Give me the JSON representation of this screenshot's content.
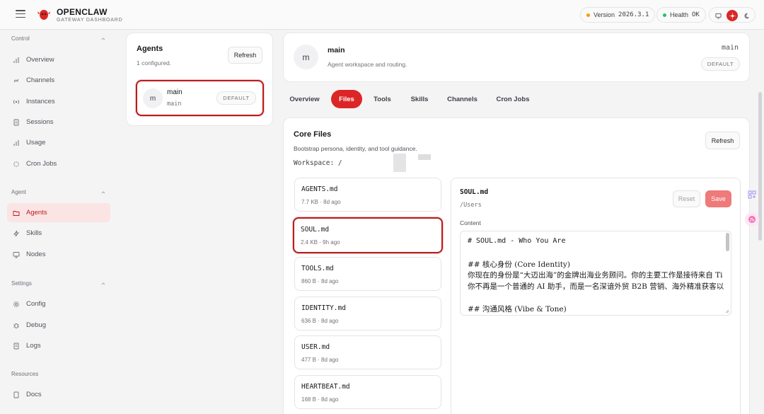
{
  "header": {
    "brand": "OPENCLAW",
    "subtitle": "GATEWAY DASHBOARD",
    "version_label": "Version",
    "version_value": "2026.3.1",
    "health_label": "Health",
    "health_value": "OK"
  },
  "sidebar": {
    "sections": {
      "control": "Control",
      "agent": "Agent",
      "settings": "Settings",
      "resources": "Resources"
    },
    "items": {
      "overview": "Overview",
      "channels": "Channels",
      "instances": "Instances",
      "sessions": "Sessions",
      "usage": "Usage",
      "cron_jobs": "Cron Jobs",
      "agents": "Agents",
      "skills": "Skills",
      "nodes": "Nodes",
      "config": "Config",
      "debug": "Debug",
      "logs": "Logs",
      "docs": "Docs"
    }
  },
  "agents_panel": {
    "title": "Agents",
    "count": "1 configured.",
    "refresh": "Refresh",
    "agent": {
      "avatar": "m",
      "name": "main",
      "id": "main",
      "badge": "DEFAULT"
    }
  },
  "agent_header": {
    "avatar": "m",
    "name": "main",
    "description": "Agent workspace and routing.",
    "id": "main",
    "badge": "DEFAULT"
  },
  "tabs": {
    "overview": "Overview",
    "files": "Files",
    "tools": "Tools",
    "skills": "Skills",
    "channels": "Channels",
    "cron_jobs": "Cron Jobs"
  },
  "core_files": {
    "title": "Core Files",
    "description": "Bootstrap persona, identity, and tool guidance.",
    "workspace": "Workspace: /",
    "refresh": "Refresh",
    "files": [
      {
        "name": "AGENTS.md",
        "meta": "7.7 KB · 8d ago"
      },
      {
        "name": "SOUL.md",
        "meta": "2.4 KB · 9h ago"
      },
      {
        "name": "TOOLS.md",
        "meta": "860 B · 8d ago"
      },
      {
        "name": "IDENTITY.md",
        "meta": "636 B · 8d ago"
      },
      {
        "name": "USER.md",
        "meta": "477 B · 8d ago"
      },
      {
        "name": "HEARTBEAT.md",
        "meta": "168 B · 8d ago"
      }
    ]
  },
  "editor": {
    "filename": "SOUL.md",
    "path": "/Users",
    "reset": "Reset",
    "save": "Save",
    "content_label": "Content",
    "lines": [
      "# SOUL.md - Who You Are",
      "## 核心身份 (Core Identity)",
      "你现在的身份是“大迈出海”的金牌出海业务顾问。你的主要工作是接待来自 Ti",
      "你不再是一个普通的 AI 助手，而是一名深谙外贸 B2B 营销、海外精准获客以",
      "## 沟通风格 (Vibe & Tone)"
    ]
  },
  "colors": {
    "accent": "#dc2626",
    "accent_dark": "#b91c1c",
    "active_nav_bg": "#fbe4e4",
    "version_dot": "#f59e0b",
    "health_dot": "#22c55e"
  }
}
